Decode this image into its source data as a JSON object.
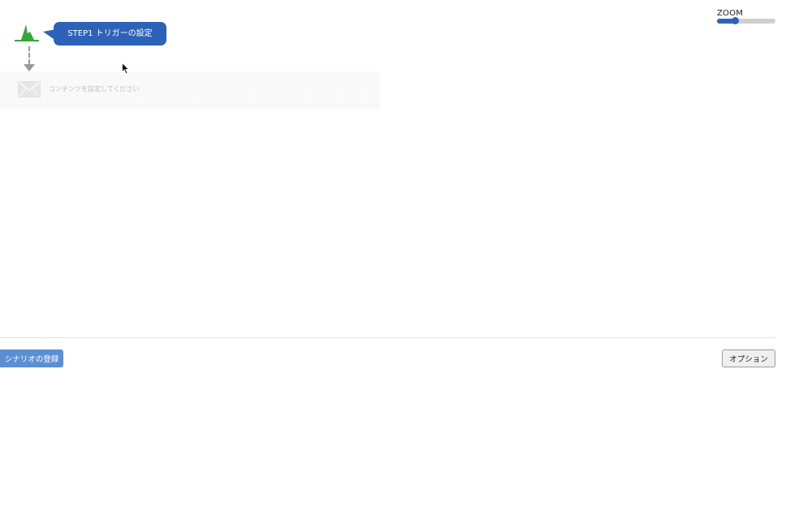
{
  "zoom": {
    "label": "ZOOM",
    "level": 0.3,
    "accent_color": "#2c63b8"
  },
  "flow": {
    "trigger": {
      "icon": "pulse-icon",
      "color": "#3aa53a"
    },
    "step1": {
      "label": "STEP1 トリガーの設定",
      "color": "#2c63b8"
    },
    "content": {
      "icon": "mail-icon",
      "hint": "コンテンツを設定してください"
    }
  },
  "footer": {
    "register_label": "シナリオの登録",
    "options_label": "オプション"
  }
}
